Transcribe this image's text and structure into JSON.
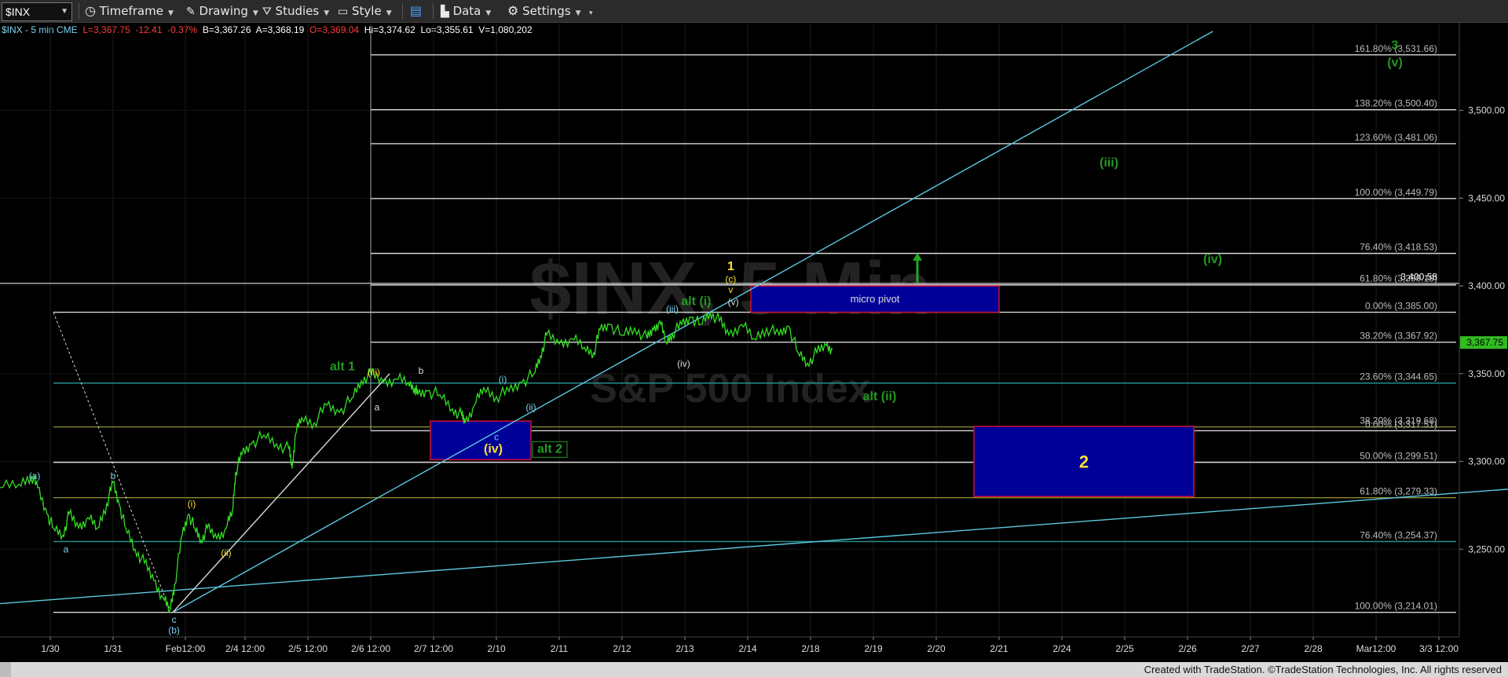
{
  "toolbar": {
    "symbol": "$INX",
    "timeframe_label": "Timeframe",
    "drawing_label": "Drawing",
    "studies_label": "Studies",
    "style_label": "Style",
    "data_label": "Data",
    "settings_label": "Settings"
  },
  "info": {
    "title": "$INX - 5 min  CME",
    "last": "L=3,367.75",
    "change": "-12.41",
    "change_pct": "-0.37%",
    "bid": "B=3,367.26",
    "ask": "A=3,368.19",
    "open": "O=3,369.04",
    "high": "Hi=3,374.62",
    "low": "Lo=3,355.61",
    "volume": "V=1,080,202"
  },
  "footer": "Created with TradeStation. ©TradeStation Technologies, Inc. All rights reserved",
  "watermark": {
    "line1": "$INX, 5 Min",
    "line2": "S&P 500 Index"
  },
  "colors": {
    "price": "#33dd22",
    "fib_white": "#d8d8d8",
    "fib_teal": "#2a8c8c",
    "fib_olive": "#8a8a30",
    "trendline": "#5bc8e0",
    "box_fill": "#000099",
    "box_border": "#d01030",
    "label_yellow": "#ffe030",
    "label_green": "#229922",
    "label_blue": "#7ad4f0",
    "label_white": "#dddddd"
  },
  "chart_data": {
    "type": "line",
    "title": "$INX - 5 min",
    "ylim": [
      3200,
      3545
    ],
    "price_axis_ticks": [
      {
        "value": 3250,
        "label": "3,250.00"
      },
      {
        "value": 3300,
        "label": "3,300.00"
      },
      {
        "value": 3350,
        "label": "3,350.00"
      },
      {
        "value": 3400,
        "label": "3,400.00"
      },
      {
        "value": 3450,
        "label": "3,450.00"
      },
      {
        "value": 3500,
        "label": "3,500.00"
      }
    ],
    "last_price": {
      "value": 3367.75,
      "label": "3,367.75"
    },
    "time_axis_ticks": [
      {
        "i": 0.8,
        "label": "1/30"
      },
      {
        "i": 1.8,
        "label": "1/31"
      },
      {
        "i": 2.95,
        "label": "Feb12:00"
      },
      {
        "i": 3.9,
        "label": "2/4 12:00"
      },
      {
        "i": 4.9,
        "label": "2/5 12:00"
      },
      {
        "i": 5.9,
        "label": "2/6 12:00"
      },
      {
        "i": 6.9,
        "label": "2/7 12:00"
      },
      {
        "i": 7.9,
        "label": "2/10"
      },
      {
        "i": 8.9,
        "label": "2/11"
      },
      {
        "i": 9.9,
        "label": "2/12"
      },
      {
        "i": 10.9,
        "label": "2/13"
      },
      {
        "i": 11.9,
        "label": "2/14"
      },
      {
        "i": 12.9,
        "label": "2/18"
      },
      {
        "i": 13.9,
        "label": "2/19"
      },
      {
        "i": 14.9,
        "label": "2/20"
      },
      {
        "i": 15.9,
        "label": "2/21"
      },
      {
        "i": 16.9,
        "label": "2/24"
      },
      {
        "i": 17.9,
        "label": "2/25"
      },
      {
        "i": 18.9,
        "label": "2/26"
      },
      {
        "i": 19.9,
        "label": "2/27"
      },
      {
        "i": 20.9,
        "label": "2/28"
      },
      {
        "i": 21.9,
        "label": "Mar12:00"
      },
      {
        "i": 22.9,
        "label": "3/3 12:00"
      }
    ],
    "series": [
      {
        "points": [
          [
            0.0,
            3285
          ],
          [
            0.3,
            3287
          ],
          [
            0.5,
            3292
          ],
          [
            0.6,
            3285
          ],
          [
            0.75,
            3270
          ],
          [
            0.85,
            3262
          ],
          [
            1.0,
            3258
          ],
          [
            1.1,
            3270
          ],
          [
            1.25,
            3262
          ],
          [
            1.4,
            3268
          ],
          [
            1.55,
            3262
          ],
          [
            1.7,
            3276
          ],
          [
            1.8,
            3288
          ],
          [
            1.9,
            3275
          ],
          [
            2.0,
            3262
          ],
          [
            2.15,
            3250
          ],
          [
            2.3,
            3242
          ],
          [
            2.45,
            3232
          ],
          [
            2.6,
            3222
          ],
          [
            2.7,
            3215
          ],
          [
            2.78,
            3230
          ],
          [
            2.9,
            3258
          ],
          [
            3.0,
            3270
          ],
          [
            3.1,
            3262
          ],
          [
            3.2,
            3255
          ],
          [
            3.3,
            3262
          ],
          [
            3.45,
            3256
          ],
          [
            3.6,
            3262
          ],
          [
            3.7,
            3272
          ],
          [
            3.75,
            3294
          ],
          [
            3.85,
            3304
          ],
          [
            4.0,
            3310
          ],
          [
            4.2,
            3315
          ],
          [
            4.4,
            3310
          ],
          [
            4.6,
            3307
          ],
          [
            4.65,
            3296
          ],
          [
            4.7,
            3315
          ],
          [
            4.8,
            3325
          ],
          [
            5.0,
            3322
          ],
          [
            5.2,
            3332
          ],
          [
            5.4,
            3328
          ],
          [
            5.6,
            3336
          ],
          [
            5.75,
            3346
          ],
          [
            5.9,
            3350
          ],
          [
            6.1,
            3345
          ],
          [
            6.3,
            3347
          ],
          [
            6.5,
            3345
          ],
          [
            6.6,
            3342
          ],
          [
            6.65,
            3338
          ],
          [
            6.8,
            3340
          ],
          [
            7.0,
            3338
          ],
          [
            7.2,
            3330
          ],
          [
            7.35,
            3326
          ],
          [
            7.4,
            3322
          ],
          [
            7.55,
            3332
          ],
          [
            7.7,
            3342
          ],
          [
            7.9,
            3337
          ],
          [
            8.1,
            3340
          ],
          [
            8.3,
            3345
          ],
          [
            8.5,
            3350
          ],
          [
            8.6,
            3360
          ],
          [
            8.7,
            3372
          ],
          [
            8.9,
            3367
          ],
          [
            9.1,
            3370
          ],
          [
            9.3,
            3365
          ],
          [
            9.45,
            3362
          ],
          [
            9.55,
            3375
          ],
          [
            9.7,
            3378
          ],
          [
            9.9,
            3372
          ],
          [
            10.1,
            3376
          ],
          [
            10.3,
            3370
          ],
          [
            10.4,
            3375
          ],
          [
            10.5,
            3380
          ],
          [
            10.6,
            3368
          ],
          [
            10.7,
            3373
          ],
          [
            10.85,
            3378
          ],
          [
            11.0,
            3382
          ],
          [
            11.15,
            3378
          ],
          [
            11.3,
            3385
          ],
          [
            11.45,
            3380
          ],
          [
            11.6,
            3372
          ],
          [
            11.8,
            3378
          ],
          [
            12.0,
            3370
          ],
          [
            12.2,
            3376
          ],
          [
            12.4,
            3372
          ],
          [
            12.55,
            3377
          ],
          [
            12.7,
            3362
          ],
          [
            12.85,
            3356
          ],
          [
            13.0,
            3362
          ],
          [
            13.15,
            3366
          ],
          [
            13.25,
            3364
          ]
        ]
      }
    ],
    "fib_levels": [
      {
        "value": 3531.66,
        "label": "161.80% (3,531.66)",
        "color": "fib_white",
        "x0": 5.9
      },
      {
        "value": 3500.4,
        "label": "138.20% (3,500.40)",
        "color": "fib_white",
        "x0": 5.9
      },
      {
        "value": 3481.06,
        "label": "123.60% (3,481.06)",
        "color": "fib_white",
        "x0": 5.9
      },
      {
        "value": 3449.79,
        "label": "100.00% (3,449.79)",
        "color": "fib_white",
        "x0": 5.9
      },
      {
        "value": 3418.53,
        "label": "76.40% (3,418.53)",
        "color": "fib_white",
        "x0": 5.9
      },
      {
        "value": 3400.58,
        "label": "61.80% (3,399.19)",
        "color": "fib_white",
        "x0": 5.9
      },
      {
        "value": 3385.0,
        "label": "0.00% (3,385.00)",
        "color": "fib_white",
        "x0": 0.85
      },
      {
        "value": 3367.92,
        "label": "38.20% (3,367.92)",
        "color": "fib_white",
        "x0": 5.9
      },
      {
        "value": 3344.65,
        "label": "23.60% (3,344.65)",
        "color": "fib_teal",
        "x0": 0.85
      },
      {
        "value": 3319.68,
        "label": "38.20% (3,319.68)",
        "color": "fib_olive",
        "x0": 0.85
      },
      {
        "value": 3317.51,
        "label": "0.00% (3,317.51)",
        "color": "fib_white",
        "x0": 5.9
      },
      {
        "value": 3299.51,
        "label": "50.00% (3,299.51)",
        "color": "fib_white",
        "x0": 0.85
      },
      {
        "value": 3279.33,
        "label": "61.80% (3,279.33)",
        "color": "fib_olive",
        "x0": 0.85
      },
      {
        "value": 3254.37,
        "label": "76.40% (3,254.37)",
        "color": "fib_teal",
        "x0": 0.85
      },
      {
        "value": 3214.01,
        "label": "100.00% (3,214.01)",
        "color": "fib_white",
        "x0": 0.85
      }
    ],
    "pivot_label": "3,400.58",
    "boxes": [
      {
        "name": "iv-box",
        "x0": 6.85,
        "x1": 8.45,
        "y0": 3301,
        "y1": 3323
      },
      {
        "name": "micro-pivot-box",
        "x0": 11.95,
        "x1": 15.9,
        "y0": 3385,
        "y1": 3400,
        "label": "micro pivot"
      },
      {
        "name": "wave-2-box",
        "x0": 15.5,
        "x1": 19.0,
        "y0": 3280,
        "y1": 3320,
        "label": "2"
      }
    ],
    "trendlines": [
      {
        "from": [
          2.75,
          3214
        ],
        "to": [
          19.3,
          3545
        ],
        "color": "trendline"
      },
      {
        "from": [
          0.0,
          3219
        ],
        "to": [
          24.3,
          3285
        ],
        "color": "trendline"
      },
      {
        "from": [
          2.75,
          3214
        ],
        "to": [
          6.2,
          3350
        ],
        "color": "fib_white"
      },
      {
        "from": [
          0.85,
          3385
        ],
        "to": [
          2.7,
          3216
        ],
        "color": "fib_white",
        "dashed": true
      }
    ],
    "wave_labels": [
      {
        "text": "(a)",
        "i": 0.55,
        "y": 3290,
        "color": "label_blue"
      },
      {
        "text": "a",
        "i": 1.05,
        "y": 3248,
        "color": "label_blue"
      },
      {
        "text": "b",
        "i": 1.8,
        "y": 3290,
        "color": "label_blue"
      },
      {
        "text": "c",
        "i": 2.77,
        "y": 3208,
        "color": "label_blue"
      },
      {
        "text": "(b)",
        "i": 2.77,
        "y": 3202,
        "color": "label_blue"
      },
      {
        "text": "(i)",
        "i": 3.05,
        "y": 3274,
        "color": "label_yellow"
      },
      {
        "text": "(ii)",
        "i": 3.6,
        "y": 3246,
        "color": "label_yellow"
      },
      {
        "text": "alt 1",
        "i": 5.45,
        "y": 3352,
        "color": "label_green",
        "big": true
      },
      {
        "text": "(iii)",
        "i": 5.95,
        "y": 3349,
        "color": "label_yellow"
      },
      {
        "text": "a",
        "i": 6.0,
        "y": 3329,
        "color": "label_white"
      },
      {
        "text": "b",
        "i": 6.7,
        "y": 3350,
        "color": "label_white"
      },
      {
        "text": "(i)",
        "i": 8.0,
        "y": 3345,
        "color": "label_blue"
      },
      {
        "text": "(ii)",
        "i": 8.45,
        "y": 3329,
        "color": "label_blue"
      },
      {
        "text": "c",
        "i": 7.9,
        "y": 3312,
        "color": "label_blue"
      },
      {
        "text": "(iv)",
        "i": 7.85,
        "y": 3305,
        "color": "label_yellow",
        "big": true
      },
      {
        "text": "alt 2",
        "i": 8.75,
        "y": 3305,
        "color": "label_green",
        "big": true,
        "boxed": true
      },
      {
        "text": "(iii)",
        "i": 10.7,
        "y": 3385,
        "color": "label_blue"
      },
      {
        "text": "(iv)",
        "i": 10.88,
        "y": 3354,
        "color": "label_white"
      },
      {
        "text": "alt (i)",
        "i": 11.08,
        "y": 3389,
        "color": "label_green",
        "big": true
      },
      {
        "text": "1",
        "i": 11.63,
        "y": 3409,
        "color": "label_yellow",
        "big": true
      },
      {
        "text": "(c)",
        "i": 11.63,
        "y": 3402,
        "color": "label_yellow"
      },
      {
        "text": "v",
        "i": 11.63,
        "y": 3396,
        "color": "label_yellow"
      },
      {
        "text": "(v)",
        "i": 11.67,
        "y": 3389,
        "color": "label_white"
      },
      {
        "text": "alt (ii)",
        "i": 14.0,
        "y": 3335,
        "color": "label_green",
        "big": true
      },
      {
        "text": "(iii)",
        "i": 17.65,
        "y": 3468,
        "color": "label_green",
        "big": true
      },
      {
        "text": "(iv)",
        "i": 19.3,
        "y": 3413,
        "color": "label_green",
        "big": true
      },
      {
        "text": "3",
        "i": 22.2,
        "y": 3535,
        "color": "label_green",
        "big": true
      },
      {
        "text": "(v)",
        "i": 22.2,
        "y": 3525,
        "color": "label_green",
        "big": true
      }
    ],
    "arrow": {
      "i": 14.6,
      "from": 3402,
      "to": 3418
    }
  }
}
